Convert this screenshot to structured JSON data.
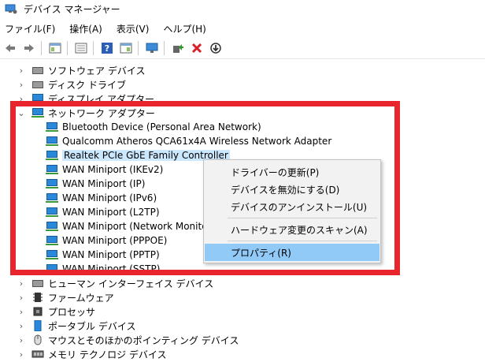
{
  "window": {
    "title": "デバイス マネージャー"
  },
  "menu": [
    "ファイル(F)",
    "操作(A)",
    "表示(V)",
    "ヘルプ(H)"
  ],
  "toolbar": {
    "icons": [
      "back-arrow-icon",
      "forward-arrow-icon",
      "properties-pane-icon",
      "list-view-icon",
      "help-icon",
      "details-pane-icon",
      "scan-monitor-icon",
      "update-driver-icon",
      "uninstall-x-icon",
      "disable-download-icon"
    ]
  },
  "tree": {
    "before": [
      "ソフトウェア デバイス",
      "ディスク ドライブ",
      "ディスプレイ アダプター"
    ],
    "network_category": "ネットワーク アダプター",
    "network_children": [
      "Bluetooth Device (Personal Area Network)",
      "Qualcomm Atheros QCA61x4A Wireless Network Adapter",
      "Realtek PCIe GbE Family Controller",
      "WAN Miniport (IKEv2)",
      "WAN Miniport (IP)",
      "WAN Miniport (IPv6)",
      "WAN Miniport (L2TP)",
      "WAN Miniport (Network Monitor)",
      "WAN Miniport (PPPOE)",
      "WAN Miniport (PPTP)",
      "WAN Miniport (SSTP)"
    ],
    "selected": "Realtek PCIe GbE Family Controller",
    "after": [
      "ヒューマン インターフェイス デバイス",
      "ファームウェア",
      "プロセッサ",
      "ポータブル デバイス",
      "マウスとそのほかのポインティング デバイス",
      "メモリ テクノロジ デバイス"
    ]
  },
  "context_menu": {
    "items": [
      "ドライバーの更新(P)",
      "デバイスを無効にする(D)",
      "デバイスのアンインストール(U)",
      "ハードウェア変更のスキャン(A)",
      "プロパティ(R)"
    ],
    "highlighted": "プロパティ(R)"
  },
  "colors": {
    "highlight": "#e8242c",
    "selection": "#cce8ff",
    "menu_hover": "#91c9f7"
  }
}
